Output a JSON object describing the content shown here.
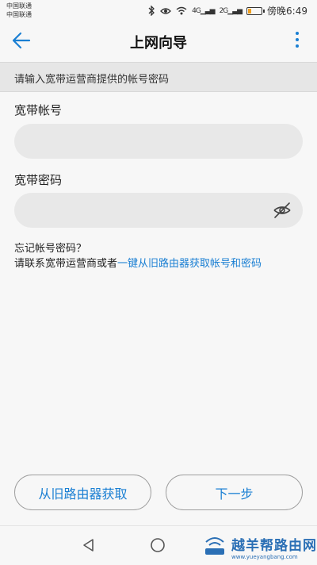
{
  "status_bar": {
    "carrier_1": "中国联通",
    "carrier_2": "中国联通",
    "net_1": "4G",
    "net_2": "2G",
    "time": "傍晚6:49",
    "battery_level": 0.2
  },
  "app_bar": {
    "title": "上网向导"
  },
  "hint": "请输入宽带运营商提供的帐号密码",
  "form": {
    "account_label": "宽带帐号",
    "account_value": "",
    "password_label": "宽带密码",
    "password_value": ""
  },
  "help": {
    "line1": "忘记帐号密码？",
    "line2_prefix": "请联系宽带运营商或者",
    "line2_link": "一键从旧路由器获取帐号和密码"
  },
  "buttons": {
    "get_from_old_router": "从旧路由器获取",
    "next_step": "下一步"
  },
  "watermark": {
    "title": "越羊帮路由网",
    "url": "www.yueyangbang.com"
  },
  "colors": {
    "accent": "#1a7fd3",
    "background": "#f7f7f7",
    "input_bg": "#e8e8e8"
  }
}
